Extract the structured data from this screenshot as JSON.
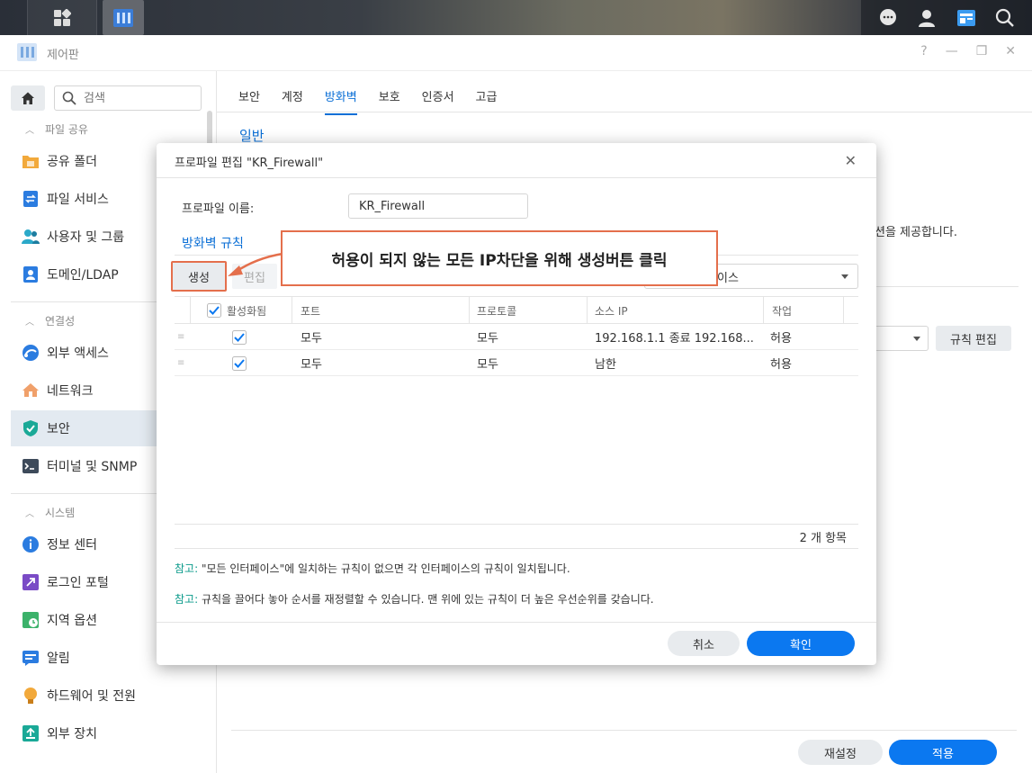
{
  "window": {
    "title": "제어판"
  },
  "sidebar": {
    "search_placeholder": "검색",
    "sections": [
      {
        "label": "파일 공유"
      },
      {
        "label": "연결성"
      },
      {
        "label": "시스템"
      }
    ],
    "items": [
      {
        "label": "공유 폴더"
      },
      {
        "label": "파일 서비스"
      },
      {
        "label": "사용자 및 그룹"
      },
      {
        "label": "도메인/LDAP"
      },
      {
        "label": "외부 액세스"
      },
      {
        "label": "네트워크"
      },
      {
        "label": "보안"
      },
      {
        "label": "터미널 및 SNMP"
      },
      {
        "label": "정보 센터"
      },
      {
        "label": "로그인 포털"
      },
      {
        "label": "지역 옵션"
      },
      {
        "label": "알림"
      },
      {
        "label": "하드웨어 및 전원"
      },
      {
        "label": "외부 장치"
      }
    ]
  },
  "tabs": [
    {
      "label": "보안"
    },
    {
      "label": "계정"
    },
    {
      "label": "방화벽"
    },
    {
      "label": "보호"
    },
    {
      "label": "인증서"
    },
    {
      "label": "고급"
    }
  ],
  "main": {
    "section_title": "일반",
    "partial_text": "션을 제공합니다.",
    "rule_edit_label": "규칙 편집",
    "reset_label": "재설정",
    "apply_label": "적용"
  },
  "modal": {
    "title": "프로파일 편집 \"KR_Firewall\"",
    "profile_label": "프로파일 이름:",
    "profile_value": "KR_Firewall",
    "rules_title": "방화벽 규칙",
    "create_label": "생성",
    "edit_label": "편집",
    "interface_visible": "이스",
    "columns": [
      "활성화됨",
      "포트",
      "프로토콜",
      "소스 IP",
      "작업"
    ],
    "rows": [
      {
        "port": "모두",
        "protocol": "모두",
        "source_ip": "192.168.1.1 종료 192.168...",
        "action": "허용"
      },
      {
        "port": "모두",
        "protocol": "모두",
        "source_ip": "남한",
        "action": "허용"
      }
    ],
    "count": "2 개 항목",
    "note_label": "참고:",
    "note1": "\"모든 인터페이스\"에 일치하는 규칙이 없으면 각 인터페이스의 규칙이 일치됩니다.",
    "note2": "규칙을 끌어다 놓아 순서를 재정렬할 수 있습니다. 맨 위에 있는 규칙이 더 높은 우선순위를 갖습니다.",
    "cancel_label": "취소",
    "ok_label": "확인"
  },
  "annotation": {
    "text": "허용이 되지 않는 모든 IP차단을 위해 생성버튼 클릭"
  },
  "colors": {
    "accent": "#0b78f0",
    "highlight": "#e46f4c",
    "note": "#0a9a8a"
  }
}
